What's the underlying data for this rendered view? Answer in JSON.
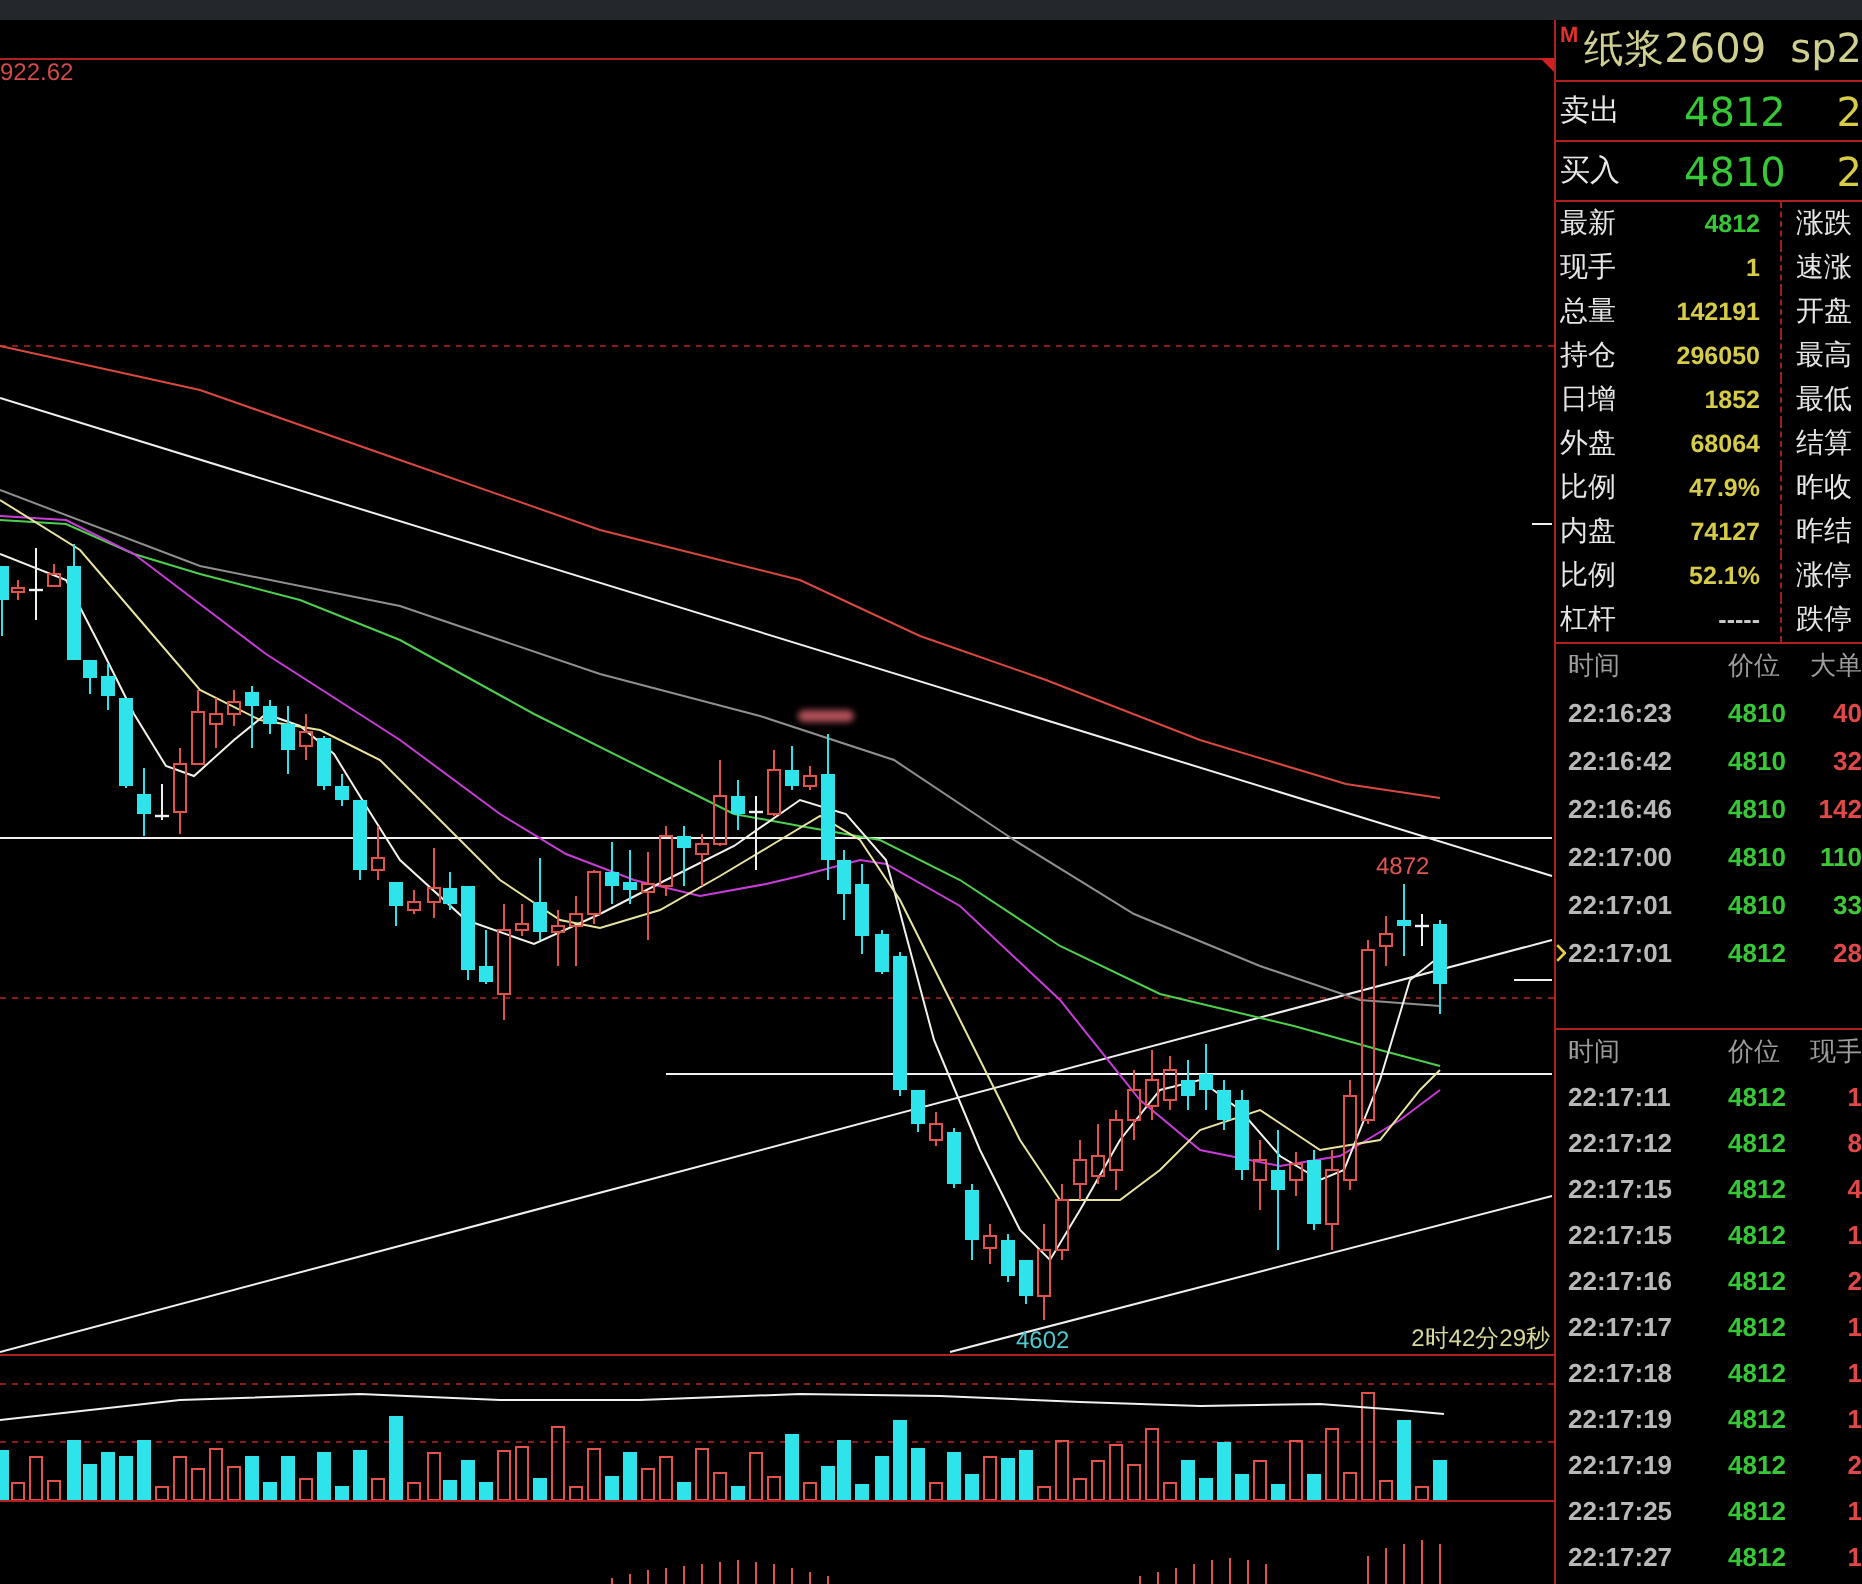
{
  "chart": {
    "top_value": "922.62",
    "high_label": "4872",
    "low_label": "4602",
    "countdown": "2时42分29秒"
  },
  "quote": {
    "badge": "M",
    "symbol": "纸浆2609",
    "code": "sp2",
    "ask": {
      "label": "卖出",
      "price": "4812",
      "volume": "2"
    },
    "bid": {
      "label": "买入",
      "price": "4810",
      "volume": "2"
    },
    "rows": [
      {
        "label": "最新",
        "value": "4812",
        "color": "#36c836",
        "label_2": "涨跌"
      },
      {
        "label": "现手",
        "value": "1",
        "color": "#d6cc48",
        "label_2": "速涨"
      },
      {
        "label": "总量",
        "value": "142191",
        "color": "#d6cc48",
        "label_2": "开盘"
      },
      {
        "label": "持仓",
        "value": "296050",
        "color": "#d6cc48",
        "label_2": "最高"
      },
      {
        "label": "日增",
        "value": "1852",
        "color": "#d6cc48",
        "label_2": "最低"
      },
      {
        "label": "外盘",
        "value": "68064",
        "color": "#d6cc48",
        "label_2": "结算"
      },
      {
        "label": "比例",
        "value": "47.9%",
        "color": "#d6cc48",
        "label_2": "昨收"
      },
      {
        "label": "内盘",
        "value": "74127",
        "color": "#d6cc48",
        "label_2": "昨结"
      },
      {
        "label": "比例",
        "value": "52.1%",
        "color": "#d6cc48",
        "label_2": "涨停"
      },
      {
        "label": "杠杆",
        "value": "-----",
        "color": "#c8c8c8",
        "label_2": "跌停"
      }
    ]
  },
  "big_orders": {
    "columns": [
      "时间",
      "价位",
      "大单"
    ],
    "rows": [
      {
        "time": "22:16:23",
        "price": "4810",
        "volume": "40",
        "color": "#e04848",
        "marked": false
      },
      {
        "time": "22:16:42",
        "price": "4810",
        "volume": "32",
        "color": "#e04848",
        "marked": false
      },
      {
        "time": "22:16:46",
        "price": "4810",
        "volume": "142",
        "color": "#e04848",
        "marked": false
      },
      {
        "time": "22:17:00",
        "price": "4810",
        "volume": "110",
        "color": "#40c838",
        "marked": false
      },
      {
        "time": "22:17:01",
        "price": "4810",
        "volume": "33",
        "color": "#40c838",
        "marked": false
      },
      {
        "time": "22:17:01",
        "price": "4812",
        "volume": "28",
        "color": "#e04848",
        "marked": true
      }
    ]
  },
  "ticks": {
    "columns": [
      "时间",
      "价位",
      "现手"
    ],
    "rows": [
      {
        "time": "22:17:11",
        "price": "4812",
        "volume": "1"
      },
      {
        "time": "22:17:12",
        "price": "4812",
        "volume": "8"
      },
      {
        "time": "22:17:15",
        "price": "4812",
        "volume": "4"
      },
      {
        "time": "22:17:15",
        "price": "4812",
        "volume": "1"
      },
      {
        "time": "22:17:16",
        "price": "4812",
        "volume": "2"
      },
      {
        "time": "22:17:17",
        "price": "4812",
        "volume": "1"
      },
      {
        "time": "22:17:18",
        "price": "4812",
        "volume": "1"
      },
      {
        "time": "22:17:19",
        "price": "4812",
        "volume": "1"
      },
      {
        "time": "22:17:19",
        "price": "4812",
        "volume": "2"
      },
      {
        "time": "22:17:25",
        "price": "4812",
        "volume": "1"
      },
      {
        "time": "22:17:27",
        "price": "4812",
        "volume": "1"
      }
    ]
  }
}
